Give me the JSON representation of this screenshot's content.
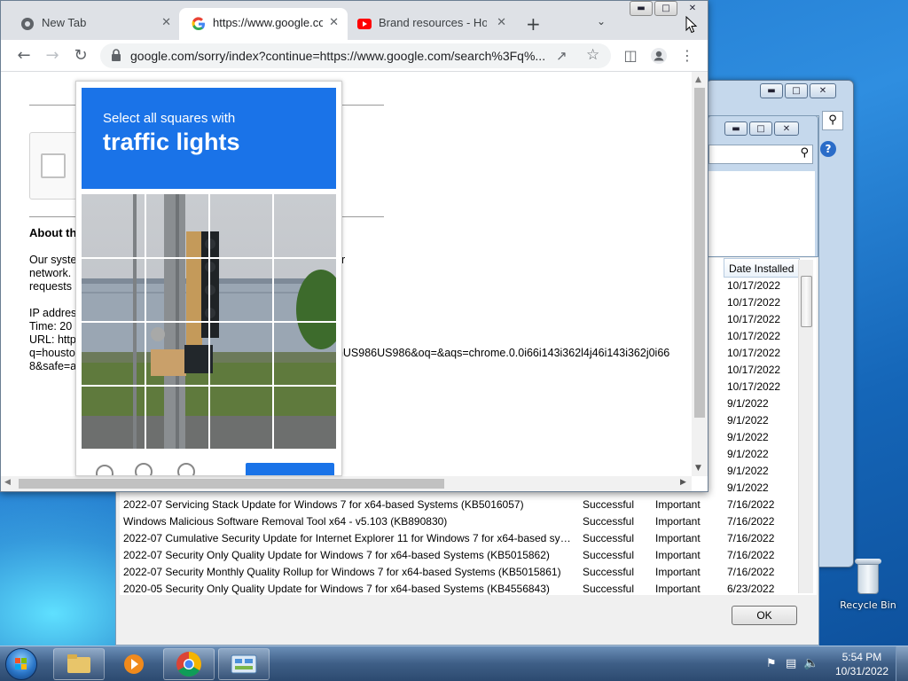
{
  "desktop": {
    "recycle_bin_label": "Recycle Bin"
  },
  "updates_window": {
    "column_date_header": "Date Installed",
    "ok_label": "OK",
    "rows": [
      {
        "name": "",
        "status": "",
        "importance": "",
        "date": "10/17/2022"
      },
      {
        "name": "",
        "status": "",
        "importance": "",
        "date": "10/17/2022"
      },
      {
        "name": "",
        "status": "",
        "importance": "",
        "date": "10/17/2022"
      },
      {
        "name": "",
        "status": "",
        "importance": "",
        "date": "10/17/2022"
      },
      {
        "name": "",
        "status": "",
        "importance": "",
        "date": "10/17/2022"
      },
      {
        "name": "",
        "status": "",
        "importance": "",
        "date": "10/17/2022"
      },
      {
        "name": "",
        "status": "",
        "importance": "",
        "date": "10/17/2022"
      },
      {
        "name": "",
        "status": "",
        "importance": "",
        "date": "9/1/2022"
      },
      {
        "name": "",
        "status": "",
        "importance": "",
        "date": "9/1/2022"
      },
      {
        "name": "",
        "status": "",
        "importance": "",
        "date": "9/1/2022"
      },
      {
        "name": "",
        "status": "",
        "importance": "",
        "date": "9/1/2022"
      },
      {
        "name": "",
        "status": "",
        "importance": "",
        "date": "9/1/2022"
      },
      {
        "name": "",
        "status": "",
        "importance": "",
        "date": "9/1/2022"
      },
      {
        "name": "2022-07 Servicing Stack Update for Windows 7 for x64-based Systems (KB5016057)",
        "status": "Successful",
        "importance": "Important",
        "date": "7/16/2022"
      },
      {
        "name": "Windows Malicious Software Removal Tool x64 - v5.103 (KB890830)",
        "status": "Successful",
        "importance": "Important",
        "date": "7/16/2022"
      },
      {
        "name": "2022-07 Cumulative Security Update for Internet Explorer 11 for Windows 7 for x64-based syste...",
        "status": "Successful",
        "importance": "Important",
        "date": "7/16/2022"
      },
      {
        "name": "2022-07 Security Only Quality Update for Windows 7 for x64-based Systems (KB5015862)",
        "status": "Successful",
        "importance": "Important",
        "date": "7/16/2022"
      },
      {
        "name": "2022-07 Security Monthly Quality Rollup for Windows 7 for x64-based Systems (KB5015861)",
        "status": "Successful",
        "importance": "Important",
        "date": "7/16/2022"
      },
      {
        "name": "2020-05 Security Only Quality Update for Windows 7 for x64-based Systems (KB4556843)",
        "status": "Successful",
        "importance": "Important",
        "date": "6/23/2022"
      }
    ]
  },
  "chrome": {
    "tabs": [
      {
        "title": "New Tab"
      },
      {
        "title": "https://www.google.co"
      },
      {
        "title": "Brand resources - How"
      }
    ],
    "url": "google.com/sorry/index?continue=https://www.google.com/search%3Fq%...",
    "page": {
      "about_heading": "About th",
      "para1_l1": "Our syste",
      "para1_l1_tail": "r",
      "para1_l2": "network.",
      "para1_l3": "requests",
      "ip_line": "IP addres",
      "time_line": "Time: 20",
      "url_line": "URL: http",
      "q_line": "q=housto",
      "q_line_tail": "enUS986US986&oq=&aqs=chrome.0.0i66i143i362l4j46i143i362j0i66",
      "safe_line": "8&safe=a"
    }
  },
  "captcha": {
    "instruction_line1": "Select all squares with",
    "instruction_line2": "traffic lights"
  },
  "taskbar": {
    "time": "5:54 PM",
    "date": "10/31/2022"
  }
}
